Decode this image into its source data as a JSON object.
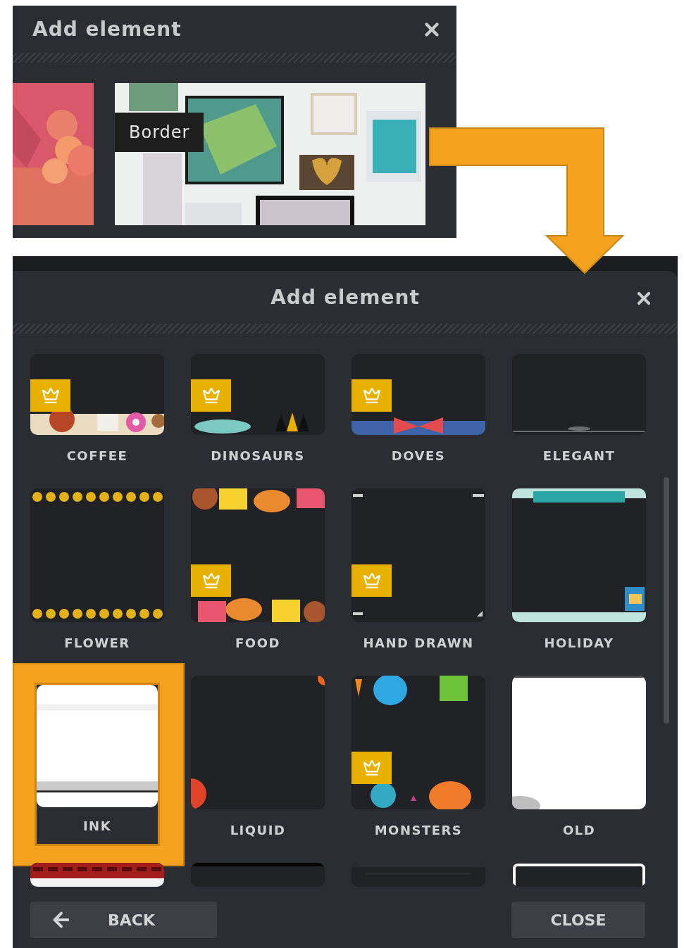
{
  "top_panel": {
    "title": "Add element",
    "cards": [
      {
        "kind": "picture"
      },
      {
        "kind": "picture",
        "label": "Border"
      }
    ]
  },
  "panel": {
    "title": "Add element",
    "tiles": [
      {
        "name": "COFFEE",
        "premium": true,
        "highlighted": false
      },
      {
        "name": "DINOSAURS",
        "premium": true,
        "highlighted": false
      },
      {
        "name": "DOVES",
        "premium": true,
        "highlighted": false
      },
      {
        "name": "ELEGANT",
        "premium": false,
        "highlighted": false
      },
      {
        "name": "FLOWER",
        "premium": false,
        "highlighted": false
      },
      {
        "name": "FOOD",
        "premium": true,
        "highlighted": false
      },
      {
        "name": "HAND DRAWN",
        "premium": true,
        "highlighted": false
      },
      {
        "name": "HOLIDAY",
        "premium": false,
        "highlighted": false
      },
      {
        "name": "INK",
        "premium": false,
        "highlighted": true
      },
      {
        "name": "LIQUID",
        "premium": false,
        "highlighted": false
      },
      {
        "name": "MONSTERS",
        "premium": true,
        "highlighted": false
      },
      {
        "name": "OLD",
        "premium": false,
        "highlighted": false
      },
      {
        "premium": false,
        "highlighted": false
      },
      {
        "premium": false,
        "highlighted": false
      },
      {
        "premium": false,
        "highlighted": false
      },
      {
        "premium": false,
        "highlighted": false
      }
    ],
    "buttons": [
      {
        "kind": "back",
        "label": "BACK"
      },
      {
        "kind": "close",
        "label": "CLOSE"
      }
    ]
  }
}
